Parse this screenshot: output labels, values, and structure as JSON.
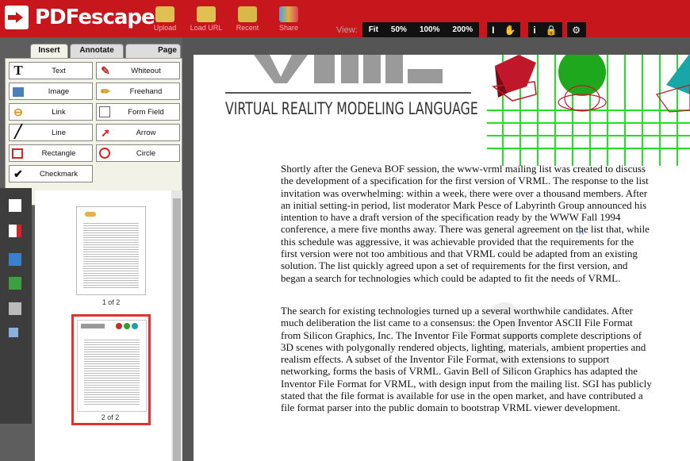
{
  "app": {
    "logo_text": "PDFescape"
  },
  "toolbar": {
    "buttons": [
      {
        "label": "Upload",
        "icon": "folder-upload-icon"
      },
      {
        "label": "Load URL",
        "icon": "folder-url-icon"
      },
      {
        "label": "Recent",
        "icon": "recent-icon"
      },
      {
        "label": "Share",
        "icon": "share-icon"
      }
    ],
    "view_label": "View:",
    "zoom": [
      "Fit",
      "50%",
      "100%",
      "200%"
    ]
  },
  "tabs": [
    "Insert",
    "Annotate",
    "Page"
  ],
  "active_tab": "Insert",
  "tools": [
    {
      "label": "Text",
      "icon": "text-icon"
    },
    {
      "label": "Whiteout",
      "icon": "whiteout-icon"
    },
    {
      "label": "Image",
      "icon": "image-icon"
    },
    {
      "label": "Freehand",
      "icon": "pencil-icon"
    },
    {
      "label": "Link",
      "icon": "link-icon"
    },
    {
      "label": "Form Field",
      "icon": "form-field-icon"
    },
    {
      "label": "Line",
      "icon": "line-icon"
    },
    {
      "label": "Arrow",
      "icon": "arrow-icon"
    },
    {
      "label": "Rectangle",
      "icon": "rectangle-icon"
    },
    {
      "label": "Circle",
      "icon": "circle-icon"
    },
    {
      "label": "Checkmark",
      "icon": "checkmark-icon"
    }
  ],
  "thumbnails": [
    {
      "label": "1 of 2"
    },
    {
      "label": "2 of 2",
      "selected": true
    }
  ],
  "document": {
    "banner_title": "VIRTUAL REALITY MODELING LANGUAGE",
    "paragraph1": [
      "Shortly after the Geneva BOF session, the www-vrml mailing list was created to discuss",
      "the development of a specification for the first version of VRML. The response to the list",
      "invitation was overwhelming: within a week, there were over a thousand members. After",
      "an initial setting-in period, list moderator Mark Pesce of Labyrinth Group announced his",
      "intention to have a draft version of the specification ready by the WWW Fall 1994",
      "conference, a mere five months away. There was general agreement on the list that, while",
      "this schedule was aggressive, it was achievable provided that the requirements for the",
      "first version were not too ambitious and that VRML could be adapted from an existing",
      "solution. The list quickly agreed upon a set of requirements for the first version, and",
      "began a search for technologies which could be adapted to fit the needs of VRML."
    ],
    "paragraph2": [
      "The search for existing technologies turned up a several worthwhile candidates. After",
      "much deliberation the list came to a consensus: the Open Inventor ASCII File Format",
      "from Silicon Graphics, Inc. The Inventor File Format supports complete descriptions of",
      "3D scenes with polygonally rendered objects, lighting, materials, ambient properties and",
      "realism effects. A subset of the Inventor File Format, with extensions to support",
      "networking, forms the basis of VRML. Gavin Bell of Silicon Graphics has adapted the",
      "Inventor File Format for VRML, with design input from the mailing list. SGI has publicly",
      "stated that the file format is available for use in the open market, and have contributed a",
      "file format parser into the public domain to bootstrap VRML viewer development."
    ]
  },
  "colors": {
    "brand_red": "#c8161d",
    "panel_gray": "#5e5e5e",
    "selection_red": "#e53030"
  }
}
